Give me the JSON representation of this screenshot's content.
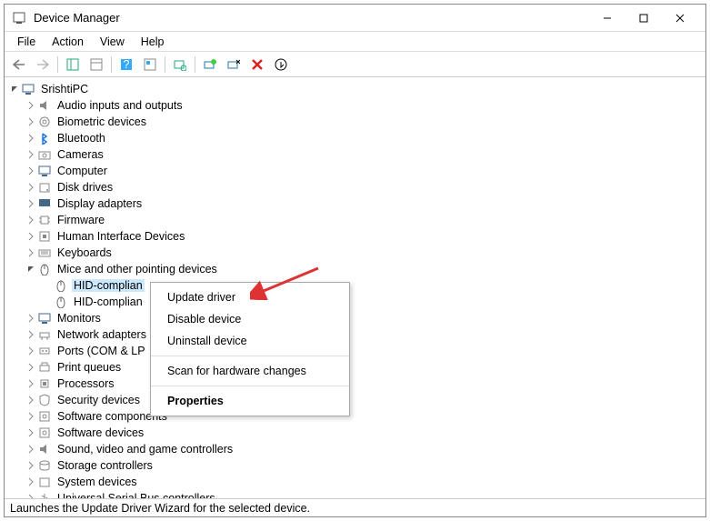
{
  "title": "Device Manager",
  "menubar": [
    "File",
    "Action",
    "View",
    "Help"
  ],
  "root_name": "SrishtiPC",
  "categories": [
    {
      "name": "Audio inputs and outputs",
      "icon": "speaker",
      "expanded": false
    },
    {
      "name": "Biometric devices",
      "icon": "fingerprint",
      "expanded": false
    },
    {
      "name": "Bluetooth",
      "icon": "bluetooth",
      "expanded": false
    },
    {
      "name": "Cameras",
      "icon": "camera",
      "expanded": false
    },
    {
      "name": "Computer",
      "icon": "monitor",
      "expanded": false
    },
    {
      "name": "Disk drives",
      "icon": "disk",
      "expanded": false
    },
    {
      "name": "Display adapters",
      "icon": "display",
      "expanded": false
    },
    {
      "name": "Firmware",
      "icon": "chip",
      "expanded": false
    },
    {
      "name": "Human Interface Devices",
      "icon": "hid",
      "expanded": false
    },
    {
      "name": "Keyboards",
      "icon": "keyboard",
      "expanded": false
    },
    {
      "name": "Mice and other pointing devices",
      "icon": "mouse",
      "expanded": true,
      "children": [
        {
          "name": "HID-complian",
          "icon": "mouse",
          "selected": true
        },
        {
          "name": "HID-complian",
          "icon": "mouse"
        }
      ]
    },
    {
      "name": "Monitors",
      "icon": "monitor",
      "expanded": false
    },
    {
      "name": "Network adapters",
      "icon": "network",
      "expanded": false
    },
    {
      "name": "Ports (COM & LP",
      "icon": "port",
      "expanded": false,
      "truncated": true
    },
    {
      "name": "Print queues",
      "icon": "printer",
      "expanded": false
    },
    {
      "name": "Processors",
      "icon": "cpu",
      "expanded": false
    },
    {
      "name": "Security devices",
      "icon": "security",
      "expanded": false
    },
    {
      "name": "Software components",
      "icon": "sw",
      "expanded": false
    },
    {
      "name": "Software devices",
      "icon": "sw",
      "expanded": false
    },
    {
      "name": "Sound, video and game controllers",
      "icon": "speaker",
      "expanded": false
    },
    {
      "name": "Storage controllers",
      "icon": "storage",
      "expanded": false
    },
    {
      "name": "System devices",
      "icon": "system",
      "expanded": false
    },
    {
      "name": "Universal Serial Bus controllers",
      "icon": "usb",
      "expanded": false,
      "cutoff": true
    }
  ],
  "context_menu": {
    "items": [
      {
        "label": "Update driver"
      },
      {
        "label": "Disable device"
      },
      {
        "label": "Uninstall device"
      },
      {
        "sep": true
      },
      {
        "label": "Scan for hardware changes"
      },
      {
        "sep": true
      },
      {
        "label": "Properties",
        "bold": true
      }
    ]
  },
  "statusbar": "Launches the Update Driver Wizard for the selected device."
}
